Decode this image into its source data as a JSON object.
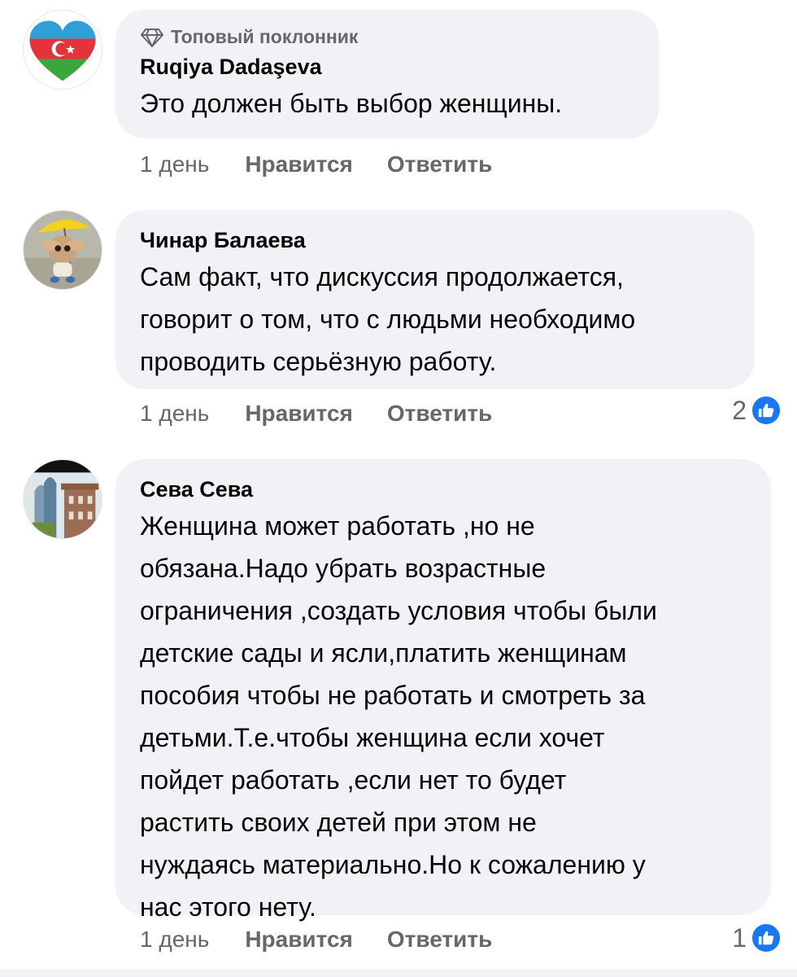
{
  "comments": [
    {
      "badge": "Топовый поклонник",
      "author": "Ruqiya Dadaşeva",
      "text": "Это должен быть выбор женщины.",
      "time": "1 день",
      "like_label": "Нравится",
      "reply_label": "Ответить",
      "likes": ""
    },
    {
      "author": "Чинар Балаева",
      "text": "Сам факт, что дискуссия продолжается,\nговорит о том, что с людьми необходимо\nпроводить серьёзную работу.",
      "time": "1 день",
      "like_label": "Нравится",
      "reply_label": "Ответить",
      "likes": "2"
    },
    {
      "author": "Сева Сева",
      "text": "Женщина может работать ,но не\nобязана.Надо убрать возрастные\nограничения ,создать условия чтобы были\nдетские сады и ясли,платить женщинам\nпособия чтобы не работать и смотреть за\nдетьми.Т.е.чтобы женщина если хочет\nпойдет работать ,если нет то будет\nрастить своих детей при этом не\nнуждаясь материально.Но к сожалению у\nнас этого нету.",
      "time": "1 день",
      "like_label": "Нравится",
      "reply_label": "Ответить",
      "likes": "1"
    }
  ],
  "icons": {
    "badge": "diamond-icon",
    "reaction": "thumbs-up-icon",
    "avatar1": "azerbaijan-heart-flag",
    "avatar2": "toy-with-umbrella-photo",
    "avatar3": "city-buildings-photo"
  },
  "colors": {
    "bubble": "#f0f2f5",
    "meta": "#65676b",
    "like_blue": "#1877f2"
  }
}
